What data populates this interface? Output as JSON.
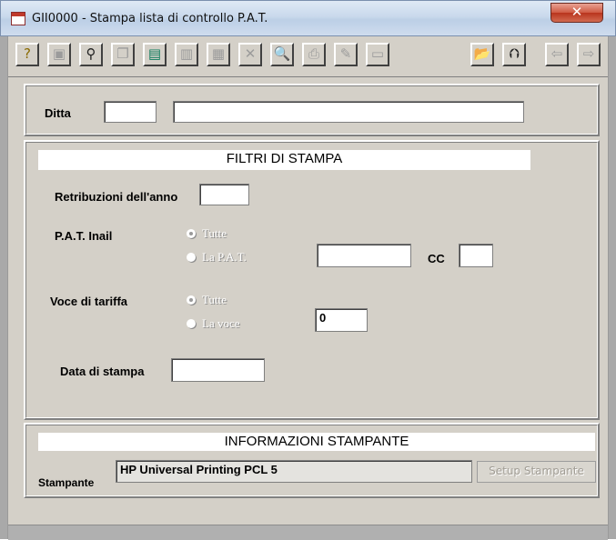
{
  "window": {
    "title": "GII0000 - Stampa lista di controllo P.A.T.",
    "close_glyph": "✕"
  },
  "toolbar": {
    "buttons": [
      {
        "name": "help",
        "glyph": "?"
      },
      {
        "name": "properties",
        "glyph": "▣"
      },
      {
        "name": "find",
        "glyph": "⚲"
      },
      {
        "name": "copy-record",
        "glyph": "❐"
      },
      {
        "name": "calculator",
        "glyph": "▤"
      },
      {
        "name": "paste",
        "glyph": "▥"
      },
      {
        "name": "table",
        "glyph": "▦"
      },
      {
        "name": "delete",
        "glyph": "✕"
      },
      {
        "name": "print-preview",
        "glyph": "🔍"
      },
      {
        "name": "print",
        "glyph": "⎙"
      },
      {
        "name": "edit",
        "glyph": "✎"
      },
      {
        "name": "note",
        "glyph": "▭"
      },
      {
        "name": "open-folder",
        "glyph": "📂"
      },
      {
        "name": "up-folder",
        "glyph": "⮉"
      },
      {
        "name": "back",
        "glyph": "⇦"
      },
      {
        "name": "forward",
        "glyph": "⇨"
      }
    ]
  },
  "ditta": {
    "label": "Ditta",
    "code": "",
    "name": ""
  },
  "filtri": {
    "header": "FILTRI DI STAMPA",
    "retribuzioni_label": "Retribuzioni dell'anno",
    "retribuzioni_value": "",
    "pat_label": "P.A.T. Inail",
    "pat_option_all": "Tutte",
    "pat_option_one": "La P.A.T.",
    "pat_value": "",
    "cc_label": "CC",
    "cc_value": "",
    "voce_label": "Voce di tariffa",
    "voce_option_all": "Tutte",
    "voce_option_one": "La voce",
    "voce_value": "0",
    "data_label": "Data di stampa",
    "data_value": ""
  },
  "stampante": {
    "header": "INFORMAZIONI STAMPANTE",
    "label": "Stampante",
    "value": "HP Universal Printing PCL 5",
    "setup_label": "Setup Stampante"
  }
}
